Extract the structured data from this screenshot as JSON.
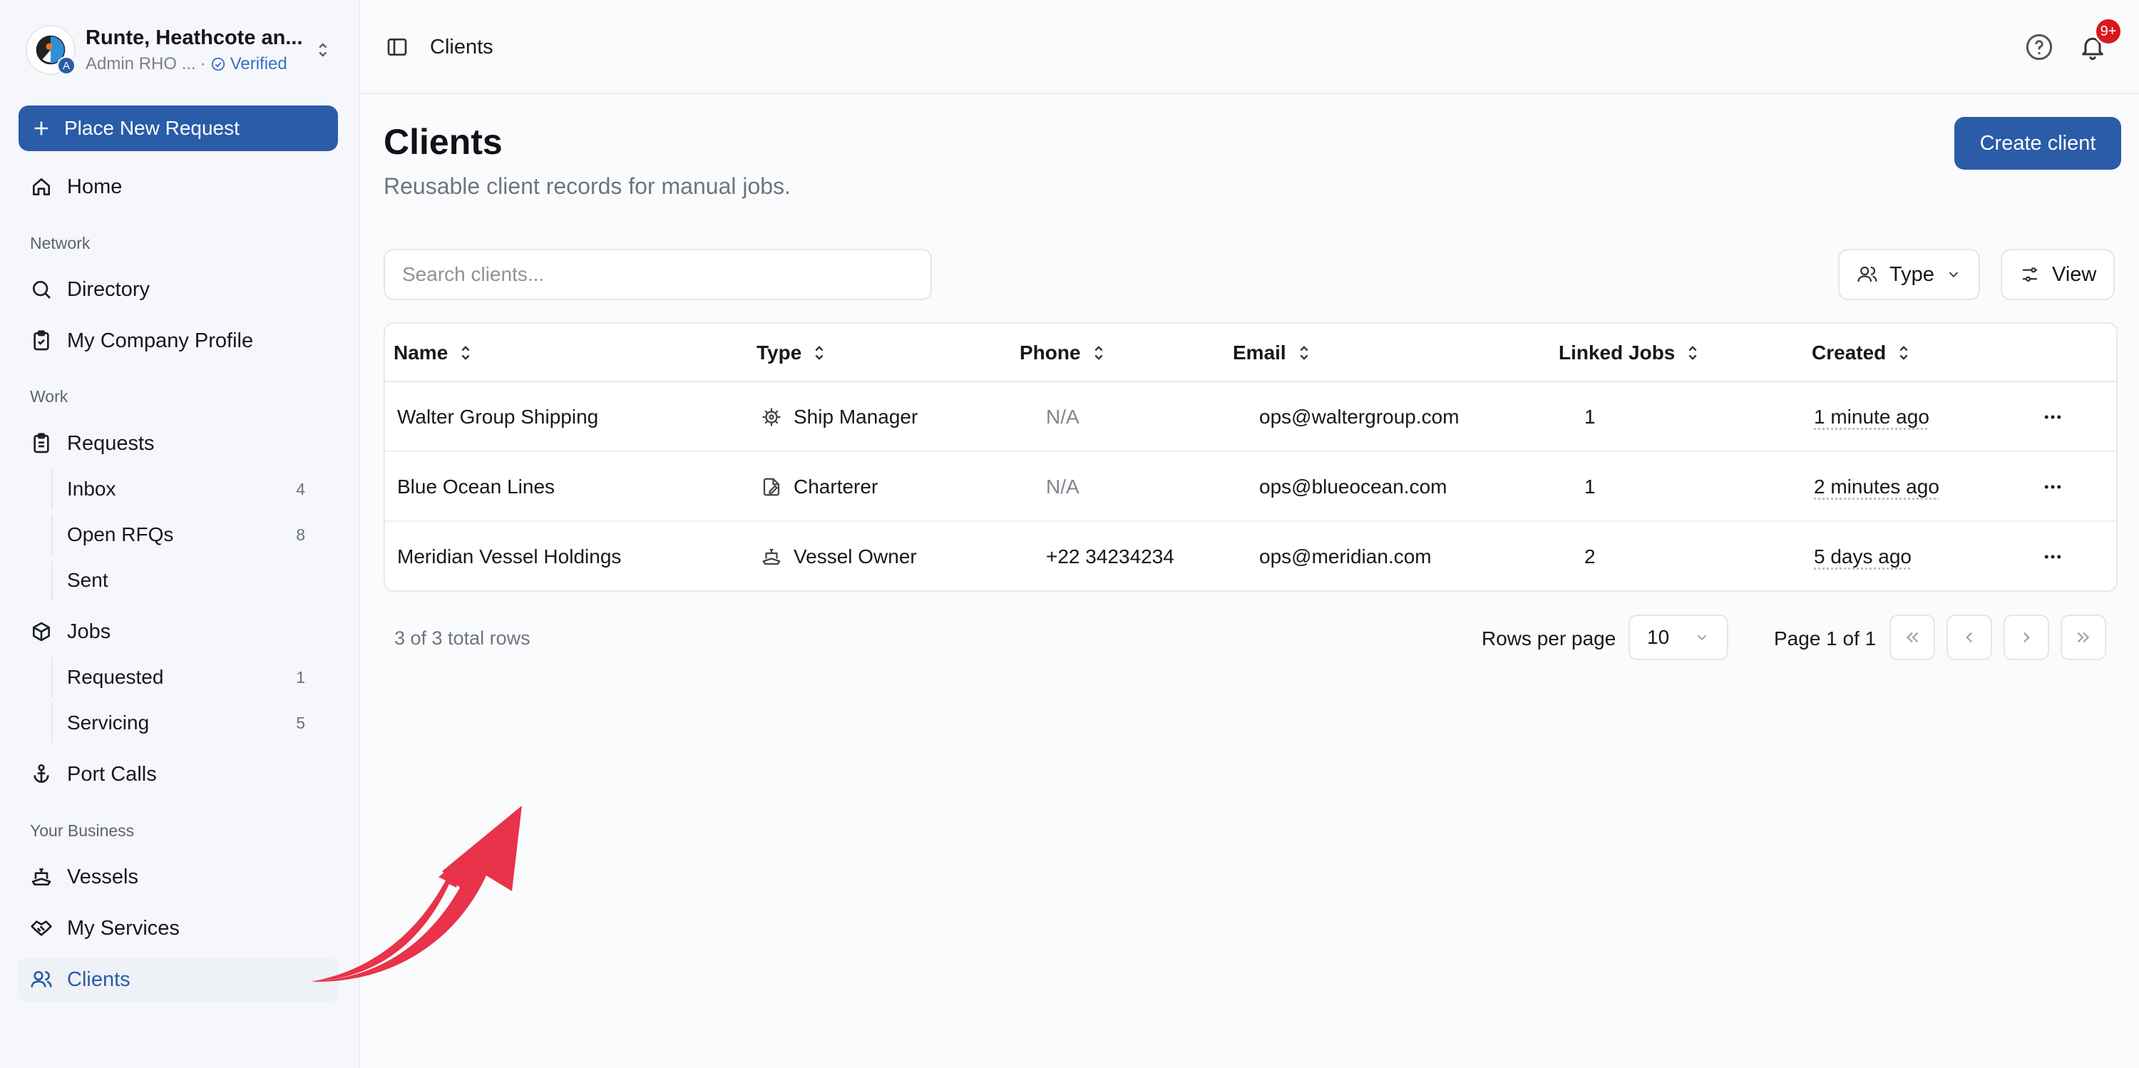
{
  "org": {
    "name": "Runte, Heathcote an...",
    "role": "Admin RHO ...",
    "verified_label": "Verified",
    "avatar_badge": "A"
  },
  "sidebar": {
    "primary_action": "Place New Request",
    "home": "Home",
    "sections": {
      "network": "Network",
      "work": "Work",
      "business": "Your Business"
    },
    "directory": "Directory",
    "company_profile": "My Company Profile",
    "requests": "Requests",
    "requests_sub": [
      {
        "label": "Inbox",
        "count": "4"
      },
      {
        "label": "Open RFQs",
        "count": "8"
      },
      {
        "label": "Sent",
        "count": ""
      }
    ],
    "jobs": "Jobs",
    "jobs_sub": [
      {
        "label": "Requested",
        "count": "1"
      },
      {
        "label": "Servicing",
        "count": "5"
      }
    ],
    "port_calls": "Port Calls",
    "vessels": "Vessels",
    "my_services": "My Services",
    "clients": "Clients"
  },
  "topbar": {
    "breadcrumb": "Clients",
    "notifications": "9+"
  },
  "page": {
    "title": "Clients",
    "subtitle": "Reusable client records for manual jobs.",
    "create_button": "Create client",
    "search_placeholder": "Search clients...",
    "filter_type": "Type",
    "view_button": "View"
  },
  "table": {
    "columns": [
      "Name",
      "Type",
      "Phone",
      "Email",
      "Linked Jobs",
      "Created"
    ],
    "rows": [
      {
        "name": "Walter Group Shipping",
        "type": "Ship Manager",
        "type_icon": "ship-wheel-icon",
        "phone": "N/A",
        "email": "ops@waltergroup.com",
        "linked_jobs": "1",
        "created": "1 minute ago"
      },
      {
        "name": "Blue Ocean Lines",
        "type": "Charterer",
        "type_icon": "contract-icon",
        "phone": "N/A",
        "email": "ops@blueocean.com",
        "linked_jobs": "1",
        "created": "2 minutes ago"
      },
      {
        "name": "Meridian Vessel Holdings",
        "type": "Vessel Owner",
        "type_icon": "ship-icon",
        "phone": "+22 34234234",
        "email": "ops@meridian.com",
        "linked_jobs": "2",
        "created": "5 days ago"
      }
    ]
  },
  "pagination": {
    "total": "3 of 3 total rows",
    "rows_per_page_label": "Rows per page",
    "rows_per_page": "10",
    "page_label": "Page 1 of 1"
  },
  "colors": {
    "accent": "#2a5ca8",
    "notification": "#d7191c",
    "annotation_arrow": "#e8334a"
  }
}
